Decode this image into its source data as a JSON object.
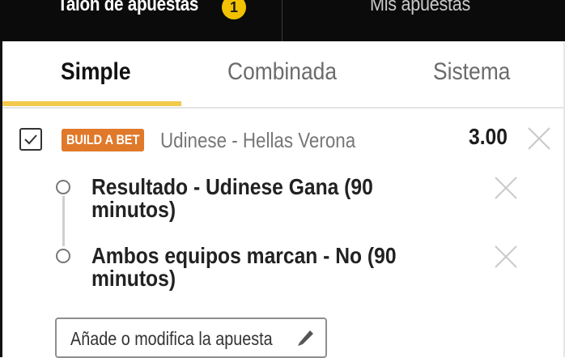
{
  "top_tabs": {
    "betslip_label": "Talón de apuestas",
    "betslip_count": "1",
    "mybets_label": "Mis apuestas"
  },
  "bet_type_tabs": [
    {
      "label": "Simple",
      "active": true
    },
    {
      "label": "Combinada",
      "active": false
    },
    {
      "label": "Sistema",
      "active": false
    }
  ],
  "bet": {
    "badge": "BUILD A BET",
    "event": "Udinese - Hellas Verona",
    "odds": "3.00",
    "selections": [
      {
        "line1": "Resultado - Udinese Gana (90",
        "line2": "minutos)"
      },
      {
        "line1": "Ambos equipos marcan - No (90",
        "line2": "minutos)"
      }
    ],
    "edit_button": "Añade o modifica la apuesta"
  },
  "colors": {
    "accent_yellow": "#f2c94c",
    "badge_orange": "#e0792a",
    "top_bar": "#0b0b0b"
  },
  "icons": [
    "check-icon",
    "close-icon",
    "pencil-icon"
  ]
}
